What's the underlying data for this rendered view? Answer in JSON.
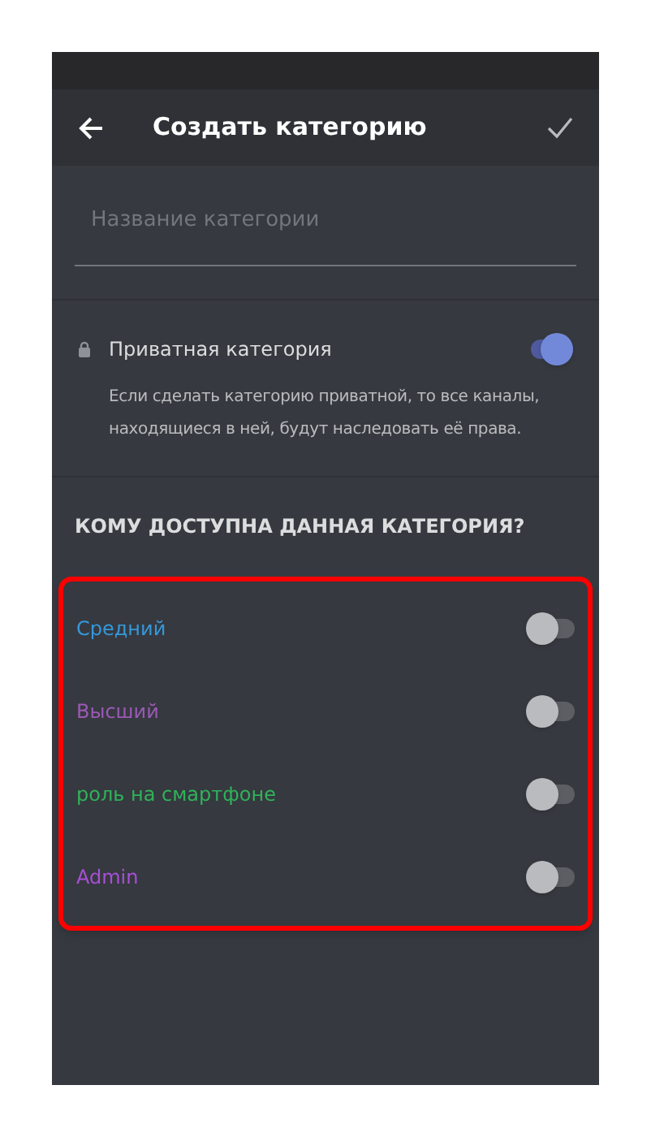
{
  "header": {
    "title": "Создать категорию"
  },
  "name_field": {
    "placeholder": "Название категории"
  },
  "private": {
    "label": "Приватная категория",
    "on": true,
    "description": "Если сделать категорию приватной, то все каналы, находящиеся в ней, будут наследовать её права."
  },
  "access": {
    "heading": "КОМУ ДОСТУПНА ДАННАЯ КАТЕГОРИЯ?",
    "roles": [
      {
        "name": "Средний",
        "color": "#3498db",
        "on": false
      },
      {
        "name": "Высший",
        "color": "#9b59b6",
        "on": false
      },
      {
        "name": "роль на смартфоне",
        "color": "#2fb35a",
        "on": false
      },
      {
        "name": "Admin",
        "color": "#a84fd8",
        "on": false
      }
    ]
  }
}
